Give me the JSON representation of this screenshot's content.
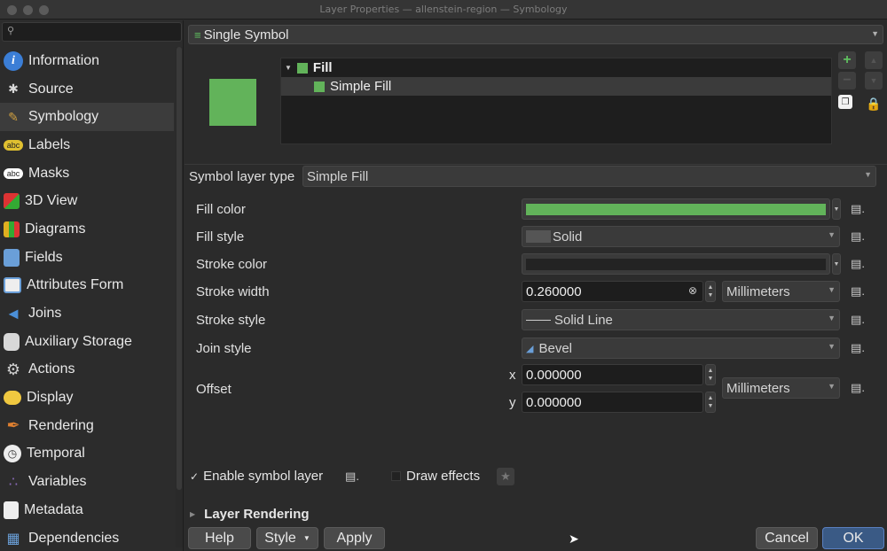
{
  "window": {
    "title": "Layer Properties — allenstein-region — Symbology"
  },
  "sidebar": {
    "search_placeholder": "",
    "items": [
      {
        "label": "Information",
        "icon": "info-icon",
        "color": "#3b7ed6"
      },
      {
        "label": "Source",
        "icon": "wrench-icon",
        "color": "#c9c9c9"
      },
      {
        "label": "Symbology",
        "icon": "paintbrush-icon",
        "color": "#d0a040"
      },
      {
        "label": "Labels",
        "icon": "abc-label-icon",
        "color": "#e0c030"
      },
      {
        "label": "Masks",
        "icon": "abc-mask-icon",
        "color": "#ffffff"
      },
      {
        "label": "3D View",
        "icon": "cube-icon",
        "color": "#d33"
      },
      {
        "label": "Diagrams",
        "icon": "diagram-icon",
        "color": "#e0b020"
      },
      {
        "label": "Fields",
        "icon": "table-icon",
        "color": "#6a9fd8"
      },
      {
        "label": "Attributes Form",
        "icon": "form-icon",
        "color": "#6a9fd8"
      },
      {
        "label": "Joins",
        "icon": "join-icon",
        "color": "#4b8fd8"
      },
      {
        "label": "Auxiliary Storage",
        "icon": "database-icon",
        "color": "#d8d8d8"
      },
      {
        "label": "Actions",
        "icon": "gear-icon",
        "color": "#cfcfcf"
      },
      {
        "label": "Display",
        "icon": "speech-bubble-icon",
        "color": "#f0c840"
      },
      {
        "label": "Rendering",
        "icon": "brush-icon",
        "color": "#e08030"
      },
      {
        "label": "Temporal",
        "icon": "clock-icon",
        "color": "#eeeeee"
      },
      {
        "label": "Variables",
        "icon": "variables-icon",
        "color": "#8a6ab8"
      },
      {
        "label": "Metadata",
        "icon": "document-icon",
        "color": "#eeeeee"
      },
      {
        "label": "Dependencies",
        "icon": "dependencies-icon",
        "color": "#6a9fd8"
      }
    ]
  },
  "renderer": {
    "label": "Single Symbol"
  },
  "symbol_tree": {
    "items": [
      {
        "label": "Fill"
      },
      {
        "label": "Simple Fill"
      }
    ]
  },
  "symbol_layer_type": {
    "label": "Symbol layer type",
    "value": "Simple Fill"
  },
  "properties": {
    "fill_color": {
      "label": "Fill color",
      "color": "#62b35a"
    },
    "fill_style": {
      "label": "Fill style",
      "value": "Solid"
    },
    "stroke_color": {
      "label": "Stroke color",
      "color": "#232323"
    },
    "stroke_width": {
      "label": "Stroke width",
      "value": "0.260000",
      "unit": "Millimeters"
    },
    "stroke_style": {
      "label": "Stroke style",
      "value": "Solid Line"
    },
    "join_style": {
      "label": "Join style",
      "value": "Bevel"
    },
    "offset": {
      "label": "Offset",
      "x_label": "x",
      "x_value": "0.000000",
      "y_label": "y",
      "y_value": "0.000000",
      "unit": "Millimeters"
    }
  },
  "enable_symbol_layer": {
    "label": "Enable symbol layer",
    "checked": true
  },
  "draw_effects": {
    "label": "Draw effects",
    "checked": false
  },
  "layer_rendering": {
    "label": "Layer Rendering"
  },
  "buttons": {
    "help": "Help",
    "style": "Style",
    "apply": "Apply",
    "cancel": "Cancel",
    "ok": "OK"
  }
}
